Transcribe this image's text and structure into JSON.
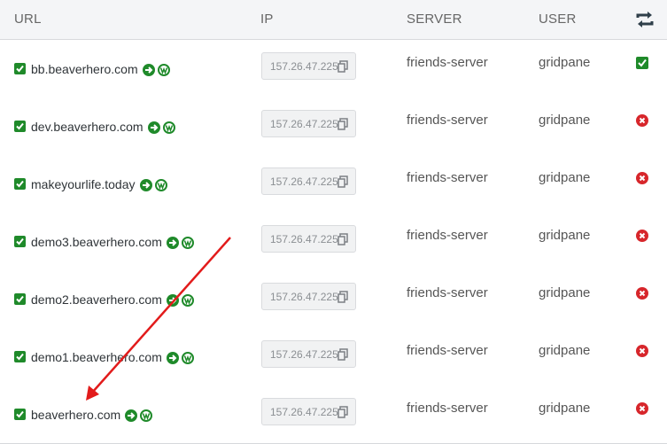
{
  "header": {
    "url": "URL",
    "ip": "IP",
    "server": "SERVER",
    "user": "USER",
    "sync_icon": "sync-icon"
  },
  "rows": [
    {
      "url": "bb.beaverhero.com",
      "ip": "157.26.47.225",
      "server": "friends-server",
      "user": "gridpane",
      "status": "enabled"
    },
    {
      "url": "dev.beaverhero.com",
      "ip": "157.26.47.225",
      "server": "friends-server",
      "user": "gridpane",
      "status": "disabled"
    },
    {
      "url": "makeyourlife.today",
      "ip": "157.26.47.225",
      "server": "friends-server",
      "user": "gridpane",
      "status": "disabled"
    },
    {
      "url": "demo3.beaverhero.com",
      "ip": "157.26.47.225",
      "server": "friends-server",
      "user": "gridpane",
      "status": "disabled"
    },
    {
      "url": "demo2.beaverhero.com",
      "ip": "157.26.47.225",
      "server": "friends-server",
      "user": "gridpane",
      "status": "disabled"
    },
    {
      "url": "demo1.beaverhero.com",
      "ip": "157.26.47.225",
      "server": "friends-server",
      "user": "gridpane",
      "status": "disabled"
    },
    {
      "url": "beaverhero.com",
      "ip": "157.26.47.225",
      "server": "friends-server",
      "user": "gridpane",
      "status": "disabled"
    }
  ],
  "colors": {
    "check_green": "#1f8a2a",
    "status_red": "#d7262b",
    "annotation_arrow": "#e21b1b"
  }
}
